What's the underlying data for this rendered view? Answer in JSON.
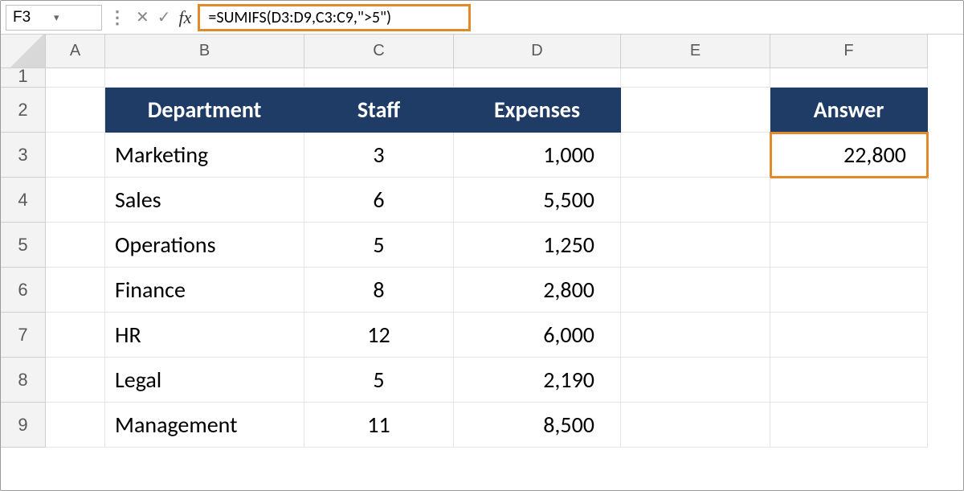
{
  "nameBox": "F3",
  "formula": "=SUMIFS(D3:D9,C3:C9,\">5\")",
  "columns": [
    "A",
    "B",
    "C",
    "D",
    "E",
    "F"
  ],
  "rows": [
    "1",
    "2",
    "3",
    "4",
    "5",
    "6",
    "7",
    "8",
    "9"
  ],
  "headers": {
    "department": "Department",
    "staff": "Staff",
    "expenses": "Expenses",
    "answer": "Answer"
  },
  "data": [
    {
      "dept": "Marketing",
      "staff": "3",
      "exp": "1,000"
    },
    {
      "dept": "Sales",
      "staff": "6",
      "exp": "5,500"
    },
    {
      "dept": "Operations",
      "staff": "5",
      "exp": "1,250"
    },
    {
      "dept": "Finance",
      "staff": "8",
      "exp": "2,800"
    },
    {
      "dept": "HR",
      "staff": "12",
      "exp": "6,000"
    },
    {
      "dept": "Legal",
      "staff": "5",
      "exp": "2,190"
    },
    {
      "dept": "Management",
      "staff": "11",
      "exp": "8,500"
    }
  ],
  "answer": "22,800"
}
